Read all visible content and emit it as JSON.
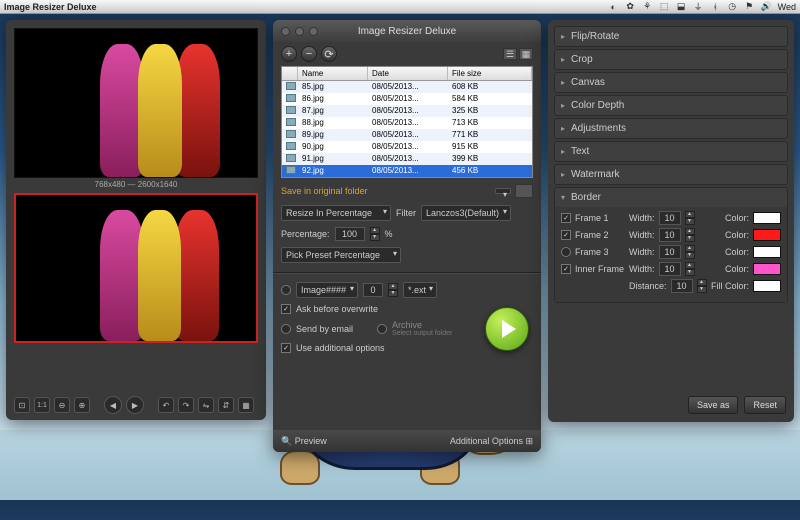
{
  "menubar": {
    "app_name": "Image Resizer Deluxe",
    "day": "Wed"
  },
  "preview": {
    "dimensions": "768x480 — 2600x1640",
    "toolbar": {
      "fit": "⊡",
      "one_to_one": "1:1",
      "zoom_out": "⊖",
      "zoom_in": "⊕",
      "prev": "◀",
      "next": "▶",
      "rotate_l": "↶",
      "rotate_r": "↷",
      "flip_h": "⇋",
      "flip_v": "⇵",
      "grid": "▦"
    }
  },
  "center": {
    "title": "Image Resizer Deluxe",
    "add": "+",
    "remove": "−",
    "refresh": "⟳",
    "table": {
      "headers": {
        "name": "Name",
        "date": "Date",
        "size": "File size"
      },
      "rows": [
        {
          "name": "85.jpg",
          "date": "08/05/2013...",
          "size": "608 KB",
          "selected": false
        },
        {
          "name": "86.jpg",
          "date": "08/05/2013...",
          "size": "584 KB",
          "selected": false
        },
        {
          "name": "87.jpg",
          "date": "08/05/2013...",
          "size": "325 KB",
          "selected": false
        },
        {
          "name": "88.jpg",
          "date": "08/05/2013...",
          "size": "713 KB",
          "selected": false
        },
        {
          "name": "89.jpg",
          "date": "08/05/2013...",
          "size": "771 KB",
          "selected": false
        },
        {
          "name": "90.jpg",
          "date": "08/05/2013...",
          "size": "915 KB",
          "selected": false
        },
        {
          "name": "91.jpg",
          "date": "08/05/2013...",
          "size": "399 KB",
          "selected": false
        },
        {
          "name": "92.jpg",
          "date": "08/05/2013...",
          "size": "456 KB",
          "selected": true
        }
      ]
    },
    "save_label": "Save in original folder",
    "resize_mode_label": "Resize In Percentage",
    "filter_label": "Filter",
    "filter_value": "Lanczos3(Default)",
    "percentage_label": "Percentage:",
    "percentage_value": "100",
    "percent_sign": "%",
    "pick_preset": "Pick Preset Percentage",
    "naming_pattern": "Image####",
    "naming_start": "0",
    "naming_ext": "*.ext",
    "ask_overwrite": "Ask before overwrite",
    "send_email": "Send by email",
    "archive": "Archive",
    "archive_sub": "Select output folder",
    "use_additional": "Use additional options",
    "preview_btn": "Preview",
    "additional_btn": "Additional Options"
  },
  "right": {
    "sections": {
      "flip": "Flip/Rotate",
      "crop": "Crop",
      "canvas": "Canvas",
      "color_depth": "Color Depth",
      "adjustments": "Adjustments",
      "text": "Text",
      "watermark": "Watermark",
      "border": "Border"
    },
    "border": {
      "frame1": "Frame 1",
      "frame2": "Frame 2",
      "frame3": "Frame 3",
      "inner": "Inner Frame",
      "width_label": "Width:",
      "width_val": "10",
      "color_label": "Color:",
      "distance_label": "Distance:",
      "distance_val": "10",
      "fill_label": "Fill Color:",
      "colors": {
        "f1": "#ffffff",
        "f2": "#ff1a1a",
        "f3": "#ffffff",
        "inner": "#ff55cc",
        "fill": "#ffffff"
      }
    },
    "save_as": "Save as",
    "reset": "Reset"
  }
}
